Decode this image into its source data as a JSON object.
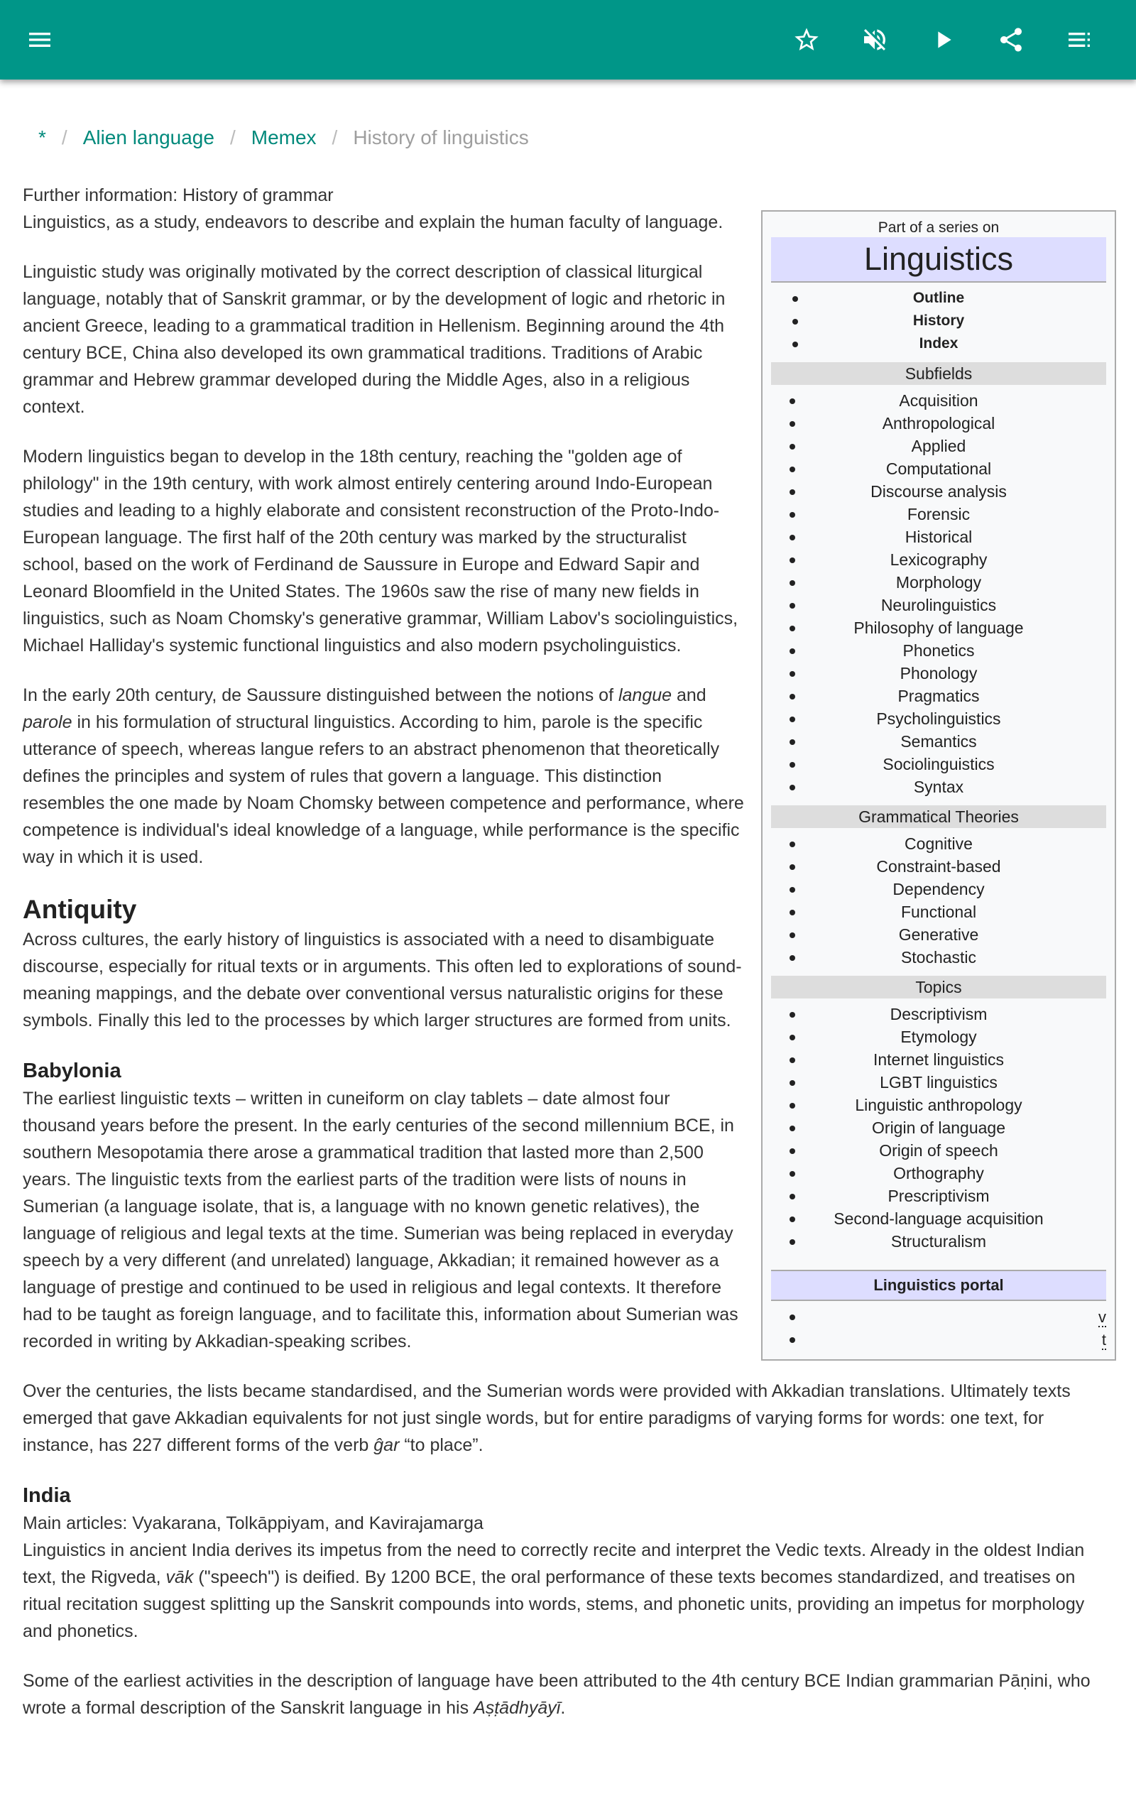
{
  "appbar": {
    "icons": [
      "menu-icon",
      "star-icon",
      "mute-icon",
      "play-icon",
      "share-icon",
      "playlist-icon"
    ]
  },
  "breadcrumb": {
    "home": "*",
    "items": [
      "Alien language",
      "Memex"
    ],
    "current": "History of linguistics"
  },
  "infobox": {
    "pre": "Part of a series on",
    "title": "Linguistics",
    "top_links": [
      "Outline",
      "History",
      "Index"
    ],
    "sections": [
      {
        "title": "Subfields",
        "items": [
          "Acquisition",
          "Anthropological",
          "Applied",
          "Computational",
          "Discourse analysis",
          "Forensic",
          "Historical",
          "Lexicography",
          "Morphology",
          "Neurolinguistics",
          "Philosophy of language",
          "Phonetics",
          "Phonology",
          "Pragmatics",
          "Psycholinguistics",
          "Semantics",
          "Sociolinguistics",
          "Syntax"
        ]
      },
      {
        "title": "Grammatical Theories",
        "items": [
          "Cognitive",
          "Constraint-based",
          "Dependency",
          "Functional",
          "Generative",
          "Stochastic"
        ]
      },
      {
        "title": "Topics",
        "items": [
          "Descriptivism",
          "Etymology",
          "Internet linguistics",
          "LGBT linguistics",
          "Linguistic anthropology",
          "Origin of language",
          "Origin of speech",
          "Orthography",
          "Prescriptivism",
          "Second-language acquisition",
          "Structuralism"
        ]
      }
    ],
    "portal": "Linguistics portal",
    "navbar": [
      "v",
      "t"
    ]
  },
  "article": [
    {
      "type": "p",
      "tight": true,
      "segs": [
        {
          "t": "Further information: History of grammar"
        }
      ]
    },
    {
      "type": "p",
      "segs": [
        {
          "t": "Linguistics, as a study, endeavors to describe and explain the human faculty of language."
        }
      ]
    },
    {
      "type": "p",
      "segs": [
        {
          "t": "Linguistic study was originally motivated by the correct description of classical liturgical language, notably that of Sanskrit grammar, or by the development of logic and rhetoric in ancient Greece, leading to a grammatical tradition in Hellenism. Beginning around the 4th century BCE, China also developed its own grammatical traditions. Traditions of Arabic grammar and Hebrew grammar developed during the Middle Ages, also in a religious context."
        }
      ]
    },
    {
      "type": "p",
      "segs": [
        {
          "t": "Modern linguistics began to develop in the 18th century, reaching the \"golden age of philology\" in the 19th century, with work almost entirely centering around Indo-European studies and leading to a highly elaborate and consistent reconstruction of the Proto-Indo-European language. The first half of the 20th century was marked by the structuralist school, based on the work of Ferdinand de Saussure in Europe and Edward Sapir and Leonard Bloomfield in the United States. The 1960s saw the rise of many new fields in linguistics, such as Noam Chomsky's generative grammar, William Labov's sociolinguistics, Michael Halliday's systemic functional linguistics and also modern psycholinguistics."
        }
      ]
    },
    {
      "type": "p",
      "segs": [
        {
          "t": "In the early 20th century, de Saussure distinguished between the notions of "
        },
        {
          "t": "langue",
          "i": true
        },
        {
          "t": " and "
        },
        {
          "t": "parole",
          "i": true
        },
        {
          "t": " in his formulation of structural linguistics. According to him, parole is the specific utterance of speech, whereas langue refers to an abstract phenomenon that theoretically defines the principles and system of rules that govern a language. This distinction resembles the one made by Noam Chomsky between competence and performance, where competence is individual's ideal knowledge of a language, while performance is the specific way in which it is used."
        }
      ]
    },
    {
      "type": "h2",
      "segs": [
        {
          "t": "Antiquity"
        }
      ]
    },
    {
      "type": "p",
      "segs": [
        {
          "t": "Across cultures, the early history of linguistics is associated with a need to disambiguate discourse, especially for ritual texts or in arguments. This often led to explorations of sound-meaning mappings, and the debate over conventional versus naturalistic origins for these symbols. Finally this led to the processes by which larger structures are formed from units."
        }
      ]
    },
    {
      "type": "h3",
      "segs": [
        {
          "t": "Babylonia"
        }
      ]
    },
    {
      "type": "p",
      "segs": [
        {
          "t": "The earliest linguistic texts – written in cuneiform on clay tablets – date almost four thousand years before the present. In the early centuries of the second millennium BCE, in southern Mesopotamia there arose a grammatical tradition that lasted more than 2,500 years. The linguistic texts from the earliest parts of the tradition were lists of nouns in Sumerian (a language isolate, that is, a language with no known genetic relatives), the language of religious and legal texts at the time. Sumerian was being replaced in everyday speech by a very different (and unrelated) language, Akkadian; it remained however as a language of prestige and continued to be used in religious and legal contexts. It therefore had to be taught as foreign language, and to facilitate this, information about Sumerian was recorded in writing by Akkadian-speaking scribes."
        }
      ]
    },
    {
      "type": "p",
      "segs": [
        {
          "t": "Over the centuries, the lists became standardised, and the Sumerian words were provided with Akkadian translations. Ultimately texts emerged that gave Akkadian equivalents for not just single words, but for entire paradigms of varying forms for words: one text, for instance, has 227 different forms of the verb "
        },
        {
          "t": "ĝar",
          "i": true
        },
        {
          "t": " “to place”."
        }
      ]
    },
    {
      "type": "h3",
      "segs": [
        {
          "t": "India"
        }
      ]
    },
    {
      "type": "p",
      "tight": true,
      "segs": [
        {
          "t": "Main articles: Vyakarana, Tolkāppiyam, and Kavirajamarga"
        }
      ]
    },
    {
      "type": "p",
      "segs": [
        {
          "t": "Linguistics in ancient India derives its impetus from the need to correctly recite and interpret the Vedic texts. Already in the oldest Indian text, the Rigveda, "
        },
        {
          "t": "vāk",
          "i": true
        },
        {
          "t": " (\"speech\") is deified. By 1200 BCE, the oral performance of these texts becomes standardized, and treatises on ritual recitation suggest splitting up the Sanskrit compounds into words, stems, and phonetic units, providing an impetus for morphology and phonetics."
        }
      ]
    },
    {
      "type": "p",
      "segs": [
        {
          "t": "Some of the earliest activities in the description of language have been attributed to the 4th century BCE Indian grammarian Pāṇini, who wrote a formal description of the Sanskrit language in his "
        },
        {
          "t": "Aṣṭādhyāyī",
          "i": true
        },
        {
          "t": "."
        }
      ]
    }
  ]
}
